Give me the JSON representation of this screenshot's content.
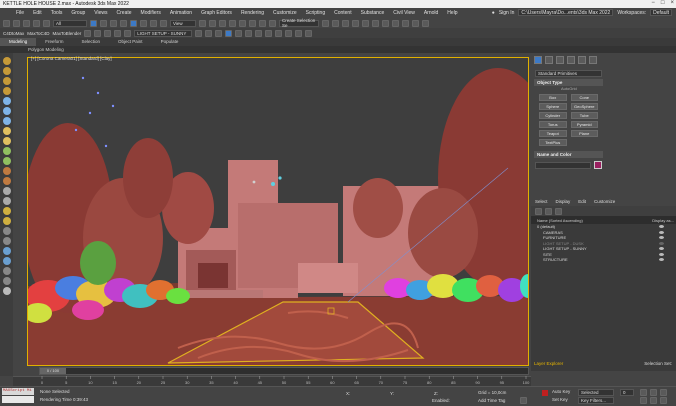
{
  "title": "KETTLE HOLE HOUSE 2.max - Autodesk 3ds Max 2022",
  "window_controls": [
    "−",
    "□",
    "×"
  ],
  "menu": [
    "File",
    "Edit",
    "Tools",
    "Group",
    "Views",
    "Create",
    "Modifiers",
    "Animation",
    "Graph Editors",
    "Rendering",
    "Customize",
    "Scripting",
    "Content",
    "Substance",
    "Civil View",
    "Arnold",
    "Help"
  ],
  "menu_right": {
    "signin": "Sign In",
    "workspaces_label": "Workspaces:",
    "workspaces_value": "Default",
    "path": "C:\\Users\\Mayra\\Do...ents\\3ds Max 2022"
  },
  "toolbar": {
    "plugins": [
      "C4DtoMax",
      "MaxToC4D",
      "MaxToBlender"
    ],
    "selection_filter": "All",
    "ref_coord": "View",
    "create_selection_set": "Create Selection Se",
    "layer_dropdown": "LIGHT SETUP - SUNNY"
  },
  "ribbon_tabs": [
    "Modeling",
    "Freeform",
    "Selection",
    "Object Paint",
    "Populate"
  ],
  "ribbon_subtab": "Polygon Modeling",
  "viewport_label": "[+] [Corona Camera01] [Standard] [Clay]",
  "command_panel": {
    "dropdown": "Standard Primitives",
    "object_type_header": "Object Type",
    "autogrid": "AutoGrid",
    "buttons": [
      "Box",
      "Cone",
      "Sphere",
      "GeoSphere",
      "Cylinder",
      "Tube",
      "Torus",
      "Pyramid",
      "Teapot",
      "Plane",
      "TextPlus"
    ],
    "name_color_header": "Name and Color",
    "swatch_color": "#9a2060"
  },
  "scene_explorer": {
    "menu": [
      "Select",
      "Display",
      "Edit",
      "Customize"
    ],
    "column_name": "Name (Sorted Ascending)",
    "column_display": "Display as...",
    "rows": [
      {
        "name": "0 (default)",
        "indent": 0,
        "dim": false
      },
      {
        "name": "CAMERAS",
        "indent": 1,
        "dim": false
      },
      {
        "name": "FURNITURE",
        "indent": 1,
        "dim": false
      },
      {
        "name": "LIGHT SETUP - DUSK",
        "indent": 1,
        "dim": true
      },
      {
        "name": "LIGHT SETUP - SUNNY",
        "indent": 1,
        "dim": false
      },
      {
        "name": "SITE",
        "indent": 1,
        "dim": false
      },
      {
        "name": "STRUCTURE",
        "indent": 1,
        "dim": false
      }
    ],
    "footer_left": "Layer Explorer",
    "footer_right": "Selection Set:"
  },
  "timeline": {
    "frame_display": "0 / 100",
    "ticks": [
      "0",
      "5",
      "10",
      "15",
      "20",
      "25",
      "30",
      "35",
      "40",
      "45",
      "50",
      "55",
      "60",
      "65",
      "70",
      "75",
      "80",
      "85",
      "90",
      "95",
      "100"
    ]
  },
  "status": {
    "maxscript": "MAXScript Mi",
    "none_selected": "None Selected",
    "rendering_time": "Rendering Time 0:39:43",
    "x_label": "X:",
    "y_label": "Y:",
    "z_label": "Z:",
    "grid": "Grid = 10,0cm",
    "enabled": "Enabled:",
    "add_time_tag": "Add Time Tag",
    "auto_key": "Auto Key",
    "set_key": "Set Key",
    "selected": "Selected",
    "key_filters": "Key Filters...",
    "frame": "0"
  }
}
